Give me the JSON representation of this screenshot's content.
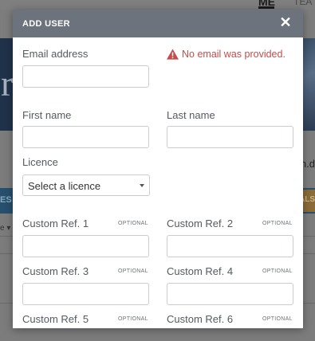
{
  "background": {
    "nav_active": "ME",
    "nav_next": "TEA",
    "hero_char": "r",
    "domain_fragment": "n.d",
    "bar_left": "ES",
    "bar_right": "ALS",
    "row_fragment": "e ▾"
  },
  "modal": {
    "title": "ADD USER",
    "close_glyph": "✕",
    "error": {
      "icon": "warning-icon",
      "text": "No email was provided.",
      "color": "#c94a4a"
    },
    "fields": {
      "email": {
        "label": "Email address",
        "value": "",
        "placeholder": ""
      },
      "first_name": {
        "label": "First name",
        "value": "",
        "placeholder": ""
      },
      "last_name": {
        "label": "Last name",
        "value": "",
        "placeholder": ""
      },
      "licence": {
        "label": "Licence",
        "selected": "Select a licence"
      },
      "custom_ref_1": {
        "label": "Custom Ref. 1",
        "optional": "OPTIONAL",
        "value": ""
      },
      "custom_ref_2": {
        "label": "Custom Ref. 2",
        "optional": "OPTIONAL",
        "value": ""
      },
      "custom_ref_3": {
        "label": "Custom Ref. 3",
        "optional": "OPTIONAL",
        "value": ""
      },
      "custom_ref_4": {
        "label": "Custom Ref. 4",
        "optional": "OPTIONAL",
        "value": ""
      },
      "custom_ref_5": {
        "label": "Custom Ref. 5",
        "optional": "OPTIONAL",
        "value": ""
      },
      "custom_ref_6": {
        "label": "Custom Ref. 6",
        "optional": "OPTIONAL",
        "value": ""
      }
    },
    "header_color": "#6c737c"
  }
}
